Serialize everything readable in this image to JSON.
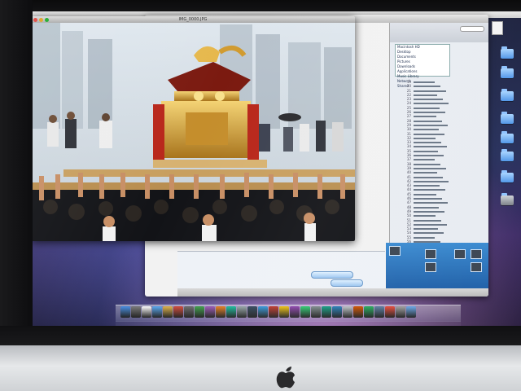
{
  "desktop": {
    "icons": [
      {
        "label": "",
        "kind": "doc"
      },
      {
        "label": "",
        "kind": "folder"
      },
      {
        "label": "",
        "kind": "folder"
      },
      {
        "label": "",
        "kind": "folder"
      },
      {
        "label": "",
        "kind": "folder"
      },
      {
        "label": "",
        "kind": "folder"
      },
      {
        "label": "",
        "kind": "folder"
      },
      {
        "label": "",
        "kind": "folder"
      },
      {
        "label": "",
        "kind": "drive"
      }
    ]
  },
  "photo_window": {
    "title": "IMG_0000.JPG"
  },
  "back_window": {
    "title": "",
    "dir_items": [
      "Macintosh HD",
      "Desktop",
      "Documents",
      "Pictures",
      "Downloads",
      "Applications",
      "Music Library",
      "Network",
      "Shared"
    ],
    "file_numbers": [
      "19",
      "20",
      "21",
      "22",
      "23",
      "24",
      "25",
      "26",
      "27",
      "28",
      "29",
      "30",
      "31",
      "32",
      "33",
      "34",
      "35",
      "36",
      "37",
      "38",
      "39",
      "40",
      "41",
      "42",
      "43",
      "44",
      "45",
      "46",
      "47",
      "48",
      "49",
      "50",
      "51",
      "52",
      "53",
      "54",
      "55",
      "56"
    ],
    "lower_text_1": "",
    "lower_text_2": "",
    "button_1": "",
    "button_2": "",
    "status": ""
  },
  "colors": {
    "accent": "#2f74c0",
    "wallpaper": "#27305c"
  }
}
